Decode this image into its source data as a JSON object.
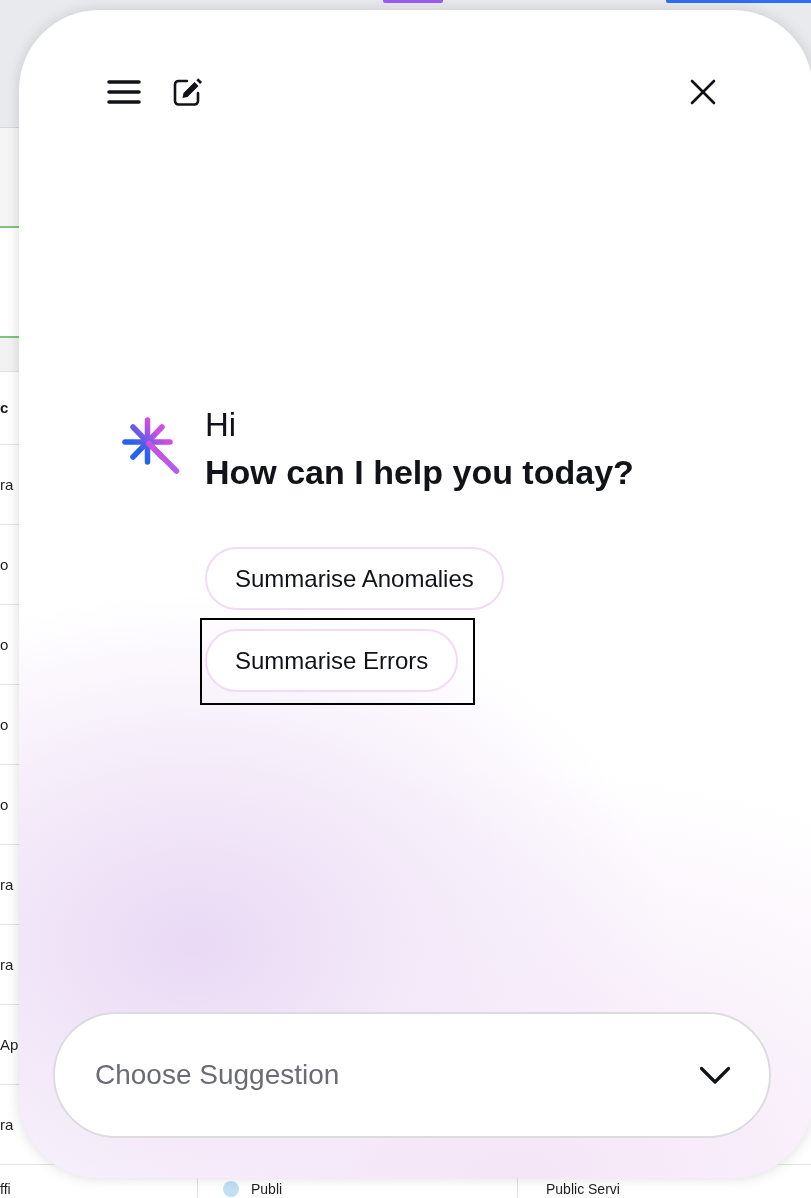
{
  "background_table": {
    "header": {
      "text": "c"
    },
    "rows": [
      {
        "cells": [
          {
            "text": "ra"
          }
        ]
      },
      {
        "cells": [
          {
            "text": "o"
          }
        ]
      },
      {
        "cells": [
          {
            "text": "o"
          }
        ]
      },
      {
        "cells": [
          {
            "text": "o"
          }
        ]
      },
      {
        "cells": [
          {
            "text": "o"
          }
        ]
      },
      {
        "cells": [
          {
            "text": "ra"
          }
        ]
      },
      {
        "cells": [
          {
            "text": "ra"
          }
        ]
      },
      {
        "cells": [
          {
            "text": "Ap"
          }
        ]
      },
      {
        "cells": [
          {
            "text": "ra"
          }
        ]
      },
      {
        "cells": [
          {
            "text": "ffi"
          },
          {
            "text": "Publi",
            "avatar": true
          },
          {
            "text": "Public Servi"
          }
        ]
      }
    ]
  },
  "assistant_panel": {
    "greeting": "Hi",
    "prompt": "How can I help you today?",
    "suggestions": [
      {
        "label": "Summarise Anomalies",
        "focused": false
      },
      {
        "label": "Summarise Errors",
        "focused": true
      }
    ],
    "suggestion_select": {
      "placeholder": "Choose Suggestion"
    }
  }
}
